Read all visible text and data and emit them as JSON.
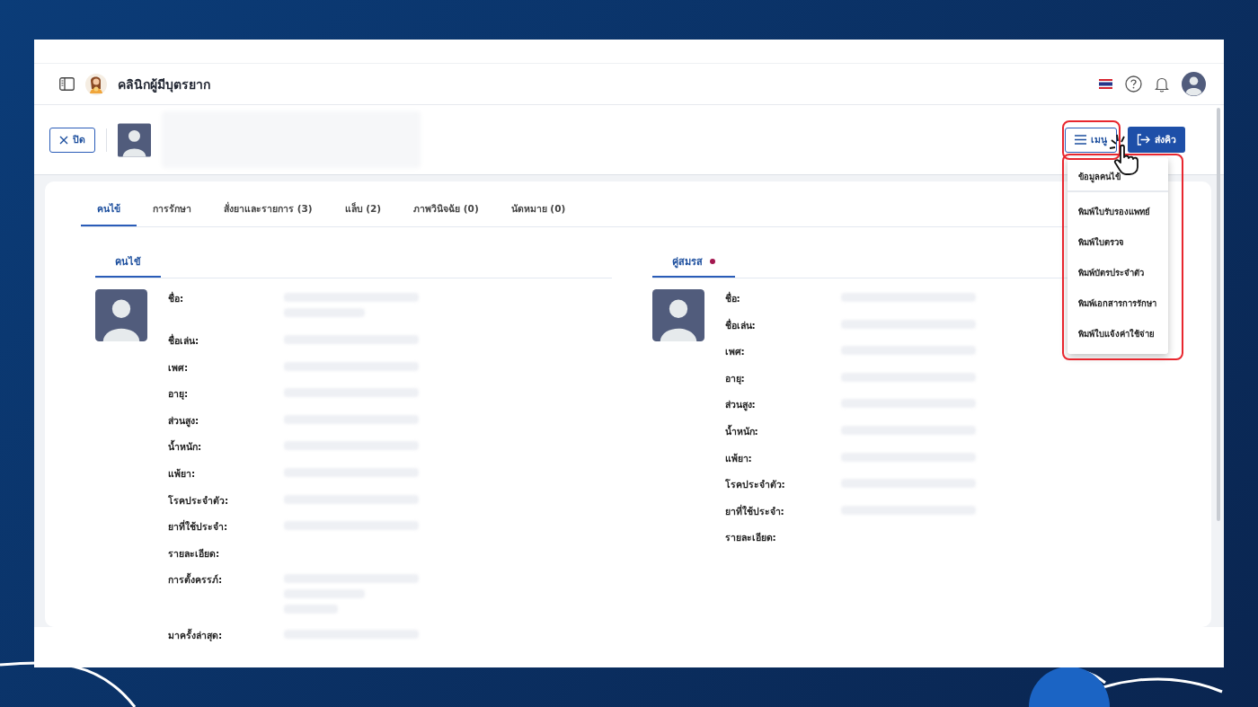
{
  "header": {
    "title": "คลินิกผู้มีบุตรยาก"
  },
  "patient_bar": {
    "close_button": "ปิด",
    "menu_button": "เมนู",
    "send_button": "ส่งคิว",
    "details_blurred": true
  },
  "tabs": [
    {
      "label": "คนไข้",
      "selected": true
    },
    {
      "label": "การรักษา",
      "selected": false
    },
    {
      "label": "สั่งยาและรายการ (3)",
      "selected": false
    },
    {
      "label": "แล็บ (2)",
      "selected": false
    },
    {
      "label": "ภาพวินิจฉัย (0)",
      "selected": false
    },
    {
      "label": "นัดหมาย (0)",
      "selected": false
    }
  ],
  "sections": [
    {
      "title": "คนไข้",
      "rows": [
        {
          "label": "ชื่อ:",
          "kind": "double"
        },
        {
          "label": "ชื่อเล่น:",
          "kind": "single"
        },
        {
          "label": "เพศ:",
          "kind": "single"
        },
        {
          "label": "อายุ:",
          "kind": "single"
        },
        {
          "label": "ส่วนสูง:",
          "kind": "single"
        },
        {
          "label": "น้ำหนัก:",
          "kind": "single"
        },
        {
          "label": "แพ้ยา:",
          "kind": "single"
        },
        {
          "label": "โรคประจำตัว:",
          "kind": "single"
        },
        {
          "label": "ยาที่ใช้ประจำ:",
          "kind": "single"
        },
        {
          "label": "รายละเอียด:",
          "kind": "empty"
        },
        {
          "label": "การตั้งครรภ์:",
          "kind": "triple"
        },
        {
          "label": "มาครั้งล่าสุด:",
          "kind": "single"
        }
      ]
    },
    {
      "title": "คู่สมรส",
      "color": "#a3174f",
      "rows": [
        {
          "label": "ชื่อ:",
          "kind": "single"
        },
        {
          "label": "ชื่อเล่น:",
          "kind": "single"
        },
        {
          "label": "เพศ:",
          "kind": "single"
        },
        {
          "label": "อายุ:",
          "kind": "single"
        },
        {
          "label": "ส่วนสูง:",
          "kind": "single"
        },
        {
          "label": "น้ำหนัก:",
          "kind": "single"
        },
        {
          "label": "แพ้ยา:",
          "kind": "single"
        },
        {
          "label": "โรคประจำตัว:",
          "kind": "single"
        },
        {
          "label": "ยาที่ใช้ประจำ:",
          "kind": "single"
        },
        {
          "label": "รายละเอียด:",
          "kind": "empty"
        }
      ]
    }
  ],
  "dropdown": {
    "open": true,
    "items": [
      {
        "label": "ข้อมูลคนไข้",
        "kind": "header"
      },
      {
        "label": "พิมพ์ใบรับรองแพทย์",
        "kind": "action"
      },
      {
        "label": "พิมพ์ใบตรวจ",
        "kind": "action"
      },
      {
        "label": "พิมพ์บัตรประจำตัว",
        "kind": "action"
      },
      {
        "label": "พิมพ์เอกสารการรักษา",
        "kind": "action"
      },
      {
        "label": "พิมพ์ใบแจ้งค่าใช้จ่าย",
        "kind": "action"
      }
    ]
  },
  "annotations": {
    "menu_button_highlighted": true,
    "dropdown_highlighted": true,
    "pointer_cursor": true
  }
}
